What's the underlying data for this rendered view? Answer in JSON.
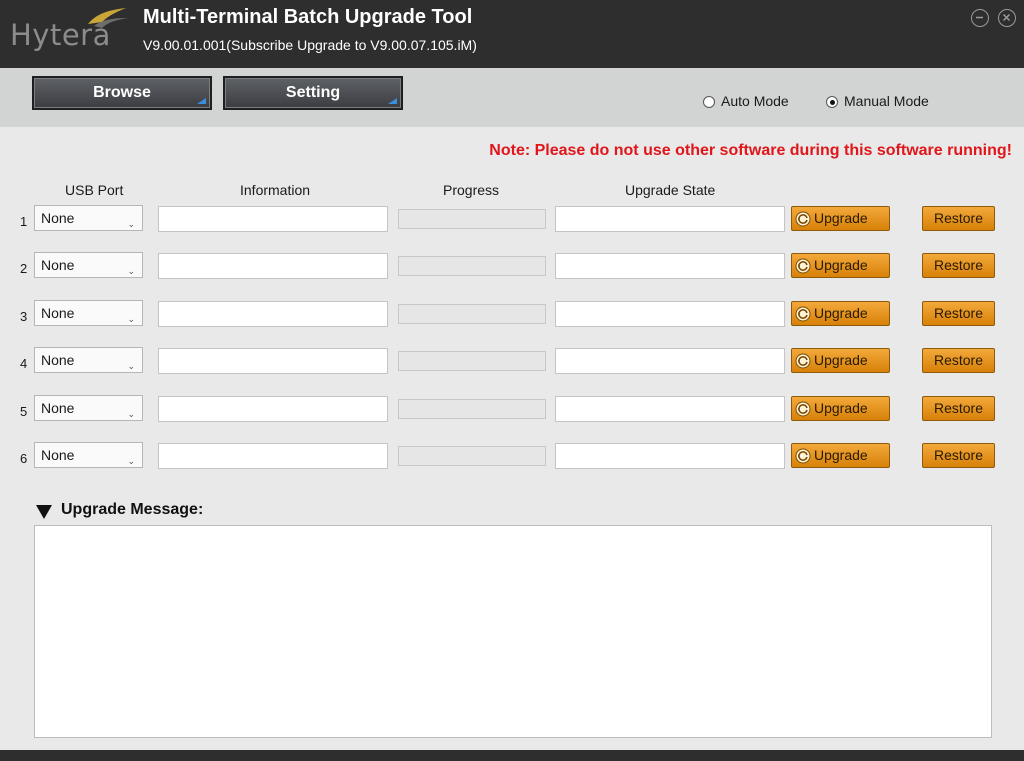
{
  "app": {
    "logo_text": "Hytera",
    "title": "Multi-Terminal Batch Upgrade Tool",
    "version": "V9.00.01.001(Subscribe Upgrade to V9.00.07.105.iM)"
  },
  "window_controls": {
    "minimize_icon": "minimize-icon",
    "close_icon": "close-icon"
  },
  "toolbar": {
    "browse_label": "Browse",
    "setting_label": "Setting",
    "modes": [
      {
        "label": "Auto Mode",
        "selected": false
      },
      {
        "label": "Manual Mode",
        "selected": true
      }
    ]
  },
  "note": "Note: Please do not use other software during this software running!",
  "columns": {
    "usb_port": "USB Port",
    "information": "Information",
    "progress": "Progress",
    "upgrade_state": "Upgrade State"
  },
  "rows": [
    {
      "num": "1",
      "port": "None",
      "information": "",
      "progress": 0,
      "state": "",
      "upgrade_label": "Upgrade",
      "restore_label": "Restore"
    },
    {
      "num": "2",
      "port": "None",
      "information": "",
      "progress": 0,
      "state": "",
      "upgrade_label": "Upgrade",
      "restore_label": "Restore"
    },
    {
      "num": "3",
      "port": "None",
      "information": "",
      "progress": 0,
      "state": "",
      "upgrade_label": "Upgrade",
      "restore_label": "Restore"
    },
    {
      "num": "4",
      "port": "None",
      "information": "",
      "progress": 0,
      "state": "",
      "upgrade_label": "Upgrade",
      "restore_label": "Restore"
    },
    {
      "num": "5",
      "port": "None",
      "information": "",
      "progress": 0,
      "state": "",
      "upgrade_label": "Upgrade",
      "restore_label": "Restore"
    },
    {
      "num": "6",
      "port": "None",
      "information": "",
      "progress": 0,
      "state": "",
      "upgrade_label": "Upgrade",
      "restore_label": "Restore"
    }
  ],
  "message": {
    "label": "Upgrade Message:",
    "content": ""
  },
  "colors": {
    "titlebar": "#2e2e2e",
    "toolbar": "#d2d3d3",
    "note": "#e0161b",
    "button_orange": "#e8950f",
    "accent_blue": "#3a8fe0"
  }
}
